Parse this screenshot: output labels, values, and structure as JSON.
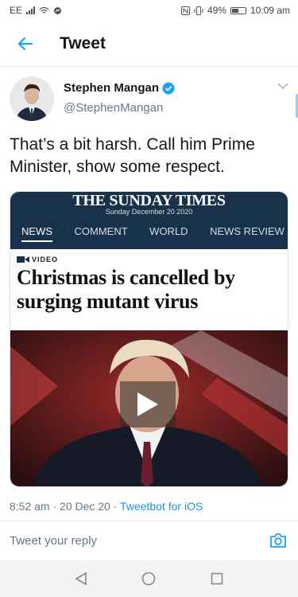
{
  "status_bar": {
    "carrier": "EE",
    "battery": "49%",
    "time": "10:09 am"
  },
  "header": {
    "title": "Tweet"
  },
  "tweet": {
    "author_name": "Stephen Mangan",
    "handle": "@StephenMangan",
    "text": "That’s a bit harsh. Call him Prime Minister, show some respect.",
    "timestamp": "8:52 am · 20 Dec 20 · ",
    "source": "Tweetbot for iOS"
  },
  "media": {
    "newspaper": "THE SUNDAY TIMES",
    "date": "Sunday December 20 2020",
    "nav": [
      "NEWS",
      "COMMENT",
      "WORLD",
      "NEWS REVIEW"
    ],
    "kicker": "VIDEO",
    "headline": "Christmas is cancelled by surging mutant virus"
  },
  "reply": {
    "placeholder": "Tweet your reply"
  },
  "colors": {
    "accent": "#1da1f2",
    "masthead": "#17324a"
  }
}
